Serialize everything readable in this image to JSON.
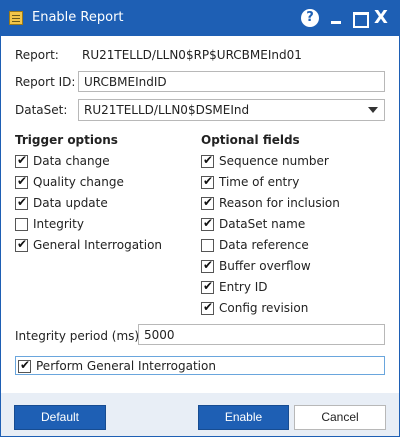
{
  "window": {
    "title": "Enable Report",
    "help_label": "?",
    "close_label": "X"
  },
  "form": {
    "report_label": "Report:",
    "report_value": "RU21TELLD/LLN0$RP$URCBMEInd01",
    "report_id_label": "Report ID:",
    "report_id_value": "URCBMEIndID",
    "dataset_label": "DataSet:",
    "dataset_value": "RU21TELLD/LLN0$DSMEInd",
    "integrity_period_label": "Integrity period (ms):",
    "integrity_period_value": "5000"
  },
  "trigger_options": {
    "title": "Trigger options",
    "items": [
      {
        "label": "Data change",
        "checked": true
      },
      {
        "label": "Quality change",
        "checked": true
      },
      {
        "label": "Data update",
        "checked": true
      },
      {
        "label": "Integrity",
        "checked": false
      },
      {
        "label": "General Interrogation",
        "checked": true
      }
    ]
  },
  "optional_fields": {
    "title": "Optional fields",
    "items": [
      {
        "label": "Sequence number",
        "checked": true
      },
      {
        "label": "Time of entry",
        "checked": true
      },
      {
        "label": "Reason for inclusion",
        "checked": true
      },
      {
        "label": "DataSet name",
        "checked": true
      },
      {
        "label": "Data reference",
        "checked": false
      },
      {
        "label": "Buffer overflow",
        "checked": true
      },
      {
        "label": "Entry ID",
        "checked": true
      },
      {
        "label": "Config revision",
        "checked": true
      }
    ]
  },
  "perform_gi": {
    "label": "Perform General Interrogation",
    "checked": true
  },
  "buttons": {
    "default_label": "Default",
    "enable_label": "Enable",
    "cancel_label": "Cancel"
  },
  "colors": {
    "accent": "#1e5fb4",
    "footer": "#e8eef6",
    "focus_border": "#6aa6dd"
  }
}
